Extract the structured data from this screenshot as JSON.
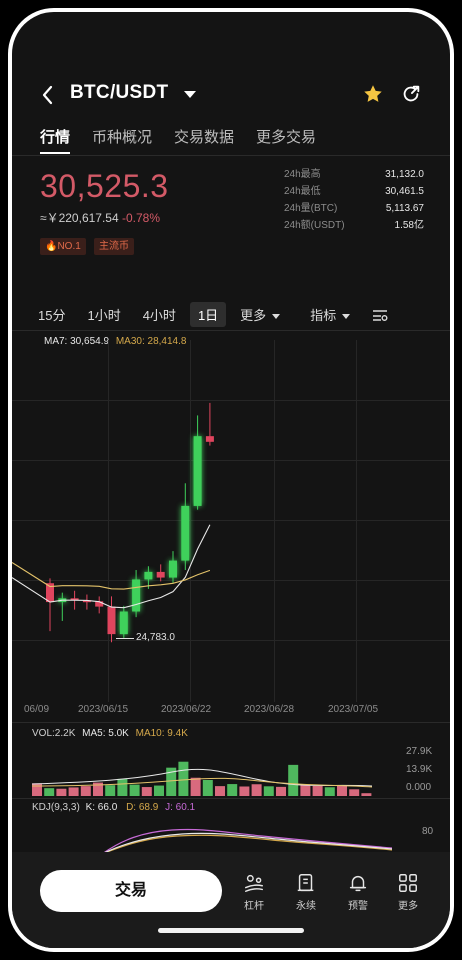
{
  "header": {
    "back_icon": "chevron-left-icon",
    "pair": "BTC/USDT",
    "favorite_icon": "star-icon",
    "favorite_color": "#f5c542",
    "share_icon": "refresh-share-icon"
  },
  "tabs": [
    {
      "label": "行情",
      "active": true
    },
    {
      "label": "币种概况",
      "active": false
    },
    {
      "label": "交易数据",
      "active": false
    },
    {
      "label": "更多交易",
      "active": false
    }
  ],
  "ticker": {
    "last_price": "30,525.3",
    "fiat_price": "≈￥220,617.54",
    "change": "-0.78%",
    "tags": [
      "NO.1",
      "主流币"
    ],
    "stats": [
      {
        "label": "24h最高",
        "value": "31,132.0"
      },
      {
        "label": "24h最低",
        "value": "30,461.5"
      },
      {
        "label": "24h量(BTC)",
        "value": "5,113.67"
      },
      {
        "label": "24h额(USDT)",
        "value": "1.58亿"
      }
    ]
  },
  "periods": {
    "items": [
      "15分",
      "1小时",
      "4小时",
      "1日"
    ],
    "selected": "1日",
    "more_label": "更多",
    "indicator_label": "指标",
    "settings_icon": "chart-settings-icon"
  },
  "main_chart": {
    "ma7_label": "MA7: 30,654.9",
    "ma30_label": "MA30: 28,414.8",
    "low_marker": "24,783.0",
    "dates": [
      "06/09",
      "2023/06/15",
      "2023/06/22",
      "2023/06/28",
      "2023/07/05"
    ],
    "colors": {
      "up": "#3fd15b",
      "down": "#e0455e",
      "ma7": "#e8e8e8",
      "ma30": "#e4c36a",
      "ma_label": "#d4a84b"
    }
  },
  "chart_data": {
    "type": "candlestick",
    "candles": [
      {
        "o": 26350,
        "h": 26480,
        "l": 25080,
        "c": 25850
      },
      {
        "o": 25850,
        "h": 26100,
        "l": 25350,
        "c": 25950
      },
      {
        "o": 25950,
        "h": 26150,
        "l": 25650,
        "c": 25900
      },
      {
        "o": 25900,
        "h": 26050,
        "l": 25650,
        "c": 25870
      },
      {
        "o": 25870,
        "h": 26000,
        "l": 25550,
        "c": 25730
      },
      {
        "o": 25730,
        "h": 26000,
        "l": 24783,
        "c": 25000
      },
      {
        "o": 25000,
        "h": 25750,
        "l": 24900,
        "c": 25600
      },
      {
        "o": 25600,
        "h": 26700,
        "l": 25450,
        "c": 26450
      },
      {
        "o": 26450,
        "h": 26800,
        "l": 26200,
        "c": 26650
      },
      {
        "o": 26650,
        "h": 26850,
        "l": 26400,
        "c": 26500
      },
      {
        "o": 26500,
        "h": 27200,
        "l": 26350,
        "c": 26950
      },
      {
        "o": 26950,
        "h": 29000,
        "l": 26700,
        "c": 28400
      },
      {
        "o": 28400,
        "h": 30800,
        "l": 28300,
        "c": 30250
      },
      {
        "o": 30250,
        "h": 31132,
        "l": 30000,
        "c": 30100
      }
    ]
  },
  "volume": {
    "vol_label": "VOL:2.2K",
    "ma5_label": "MA5: 5.0K",
    "ma10_label": "MA10: 9.4K",
    "axis": [
      "27.9K",
      "13.9K",
      "0.000"
    ],
    "bars": [
      {
        "v": 6800,
        "up": false
      },
      {
        "v": 4200,
        "up": true
      },
      {
        "v": 3900,
        "up": false
      },
      {
        "v": 4600,
        "up": false
      },
      {
        "v": 5300,
        "up": false
      },
      {
        "v": 7200,
        "up": false
      },
      {
        "v": 5800,
        "up": true
      },
      {
        "v": 9200,
        "up": true
      },
      {
        "v": 6100,
        "up": true
      },
      {
        "v": 4800,
        "up": false
      },
      {
        "v": 5600,
        "up": true
      },
      {
        "v": 15200,
        "up": true
      },
      {
        "v": 18400,
        "up": true
      },
      {
        "v": 9800,
        "up": false
      },
      {
        "v": 8600,
        "up": true
      },
      {
        "v": 5300,
        "up": false
      },
      {
        "v": 6400,
        "up": true
      },
      {
        "v": 5100,
        "up": false
      },
      {
        "v": 6300,
        "up": false
      },
      {
        "v": 5200,
        "up": true
      },
      {
        "v": 4900,
        "up": false
      },
      {
        "v": 16700,
        "up": true
      },
      {
        "v": 6200,
        "up": false
      },
      {
        "v": 5400,
        "up": false
      },
      {
        "v": 4700,
        "up": true
      },
      {
        "v": 5800,
        "up": false
      },
      {
        "v": 3600,
        "up": false
      },
      {
        "v": 1500,
        "up": false
      }
    ]
  },
  "kdj": {
    "label": "KDJ(9,3,3)",
    "k_label": "K: 66.0",
    "d_label": "D: 68.9",
    "j_label": "J: 60.1",
    "axis": "80"
  },
  "bottom_nav": {
    "trade_label": "交易",
    "items": [
      {
        "label": "杠杆",
        "icon": "leverage-icon"
      },
      {
        "label": "永续",
        "icon": "perpetual-icon"
      },
      {
        "label": "预警",
        "icon": "bell-icon"
      },
      {
        "label": "更多",
        "icon": "grid-icon"
      }
    ]
  }
}
